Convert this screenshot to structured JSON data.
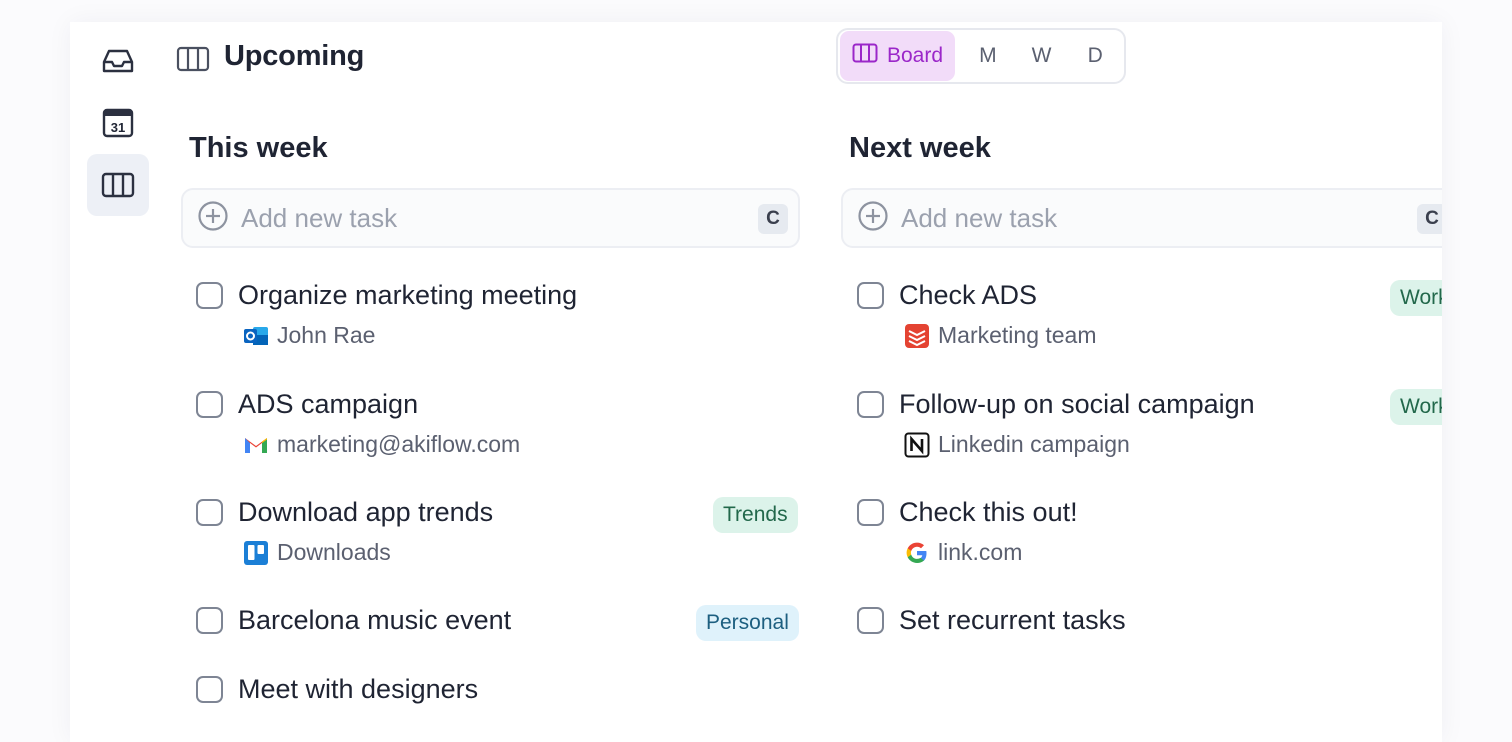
{
  "header": {
    "title": "Upcoming",
    "views": [
      {
        "label": "Board",
        "active": true
      },
      {
        "label": "M",
        "active": false
      },
      {
        "label": "W",
        "active": false
      },
      {
        "label": "D",
        "active": false
      }
    ]
  },
  "sidebar": {
    "items": [
      {
        "icon": "inbox-icon"
      },
      {
        "icon": "calendar-icon",
        "label": "31"
      },
      {
        "icon": "board-icon",
        "active": true
      }
    ]
  },
  "columns": [
    {
      "title": "This week",
      "add_placeholder": "Add new task",
      "shortcut": "C",
      "tasks": [
        {
          "title": "Organize marketing meeting",
          "source": "John Rae",
          "source_icon": "outlook-icon"
        },
        {
          "title": "ADS campaign",
          "source": "marketing@akiflow.com",
          "source_icon": "gmail-icon"
        },
        {
          "title": "Download app trends",
          "source": "Downloads",
          "source_icon": "trello-icon",
          "tag": "Trends"
        },
        {
          "title": "Barcelona music event",
          "tag": "Personal"
        },
        {
          "title": "Meet with designers"
        }
      ]
    },
    {
      "title": "Next week",
      "add_placeholder": "Add new task",
      "shortcut": "C",
      "tasks": [
        {
          "title": "Check ADS",
          "source": "Marketing team",
          "source_icon": "todoist-icon",
          "tag": "Work"
        },
        {
          "title": "Follow-up on social campaign",
          "source": "Linkedin campaign",
          "source_icon": "notion-icon",
          "tag": "Work"
        },
        {
          "title": "Check this out!",
          "source": "link.com",
          "source_icon": "google-icon"
        },
        {
          "title": "Set recurrent tasks"
        }
      ]
    }
  ],
  "colors": {
    "accent": "#9b27c9",
    "accent_bg": "#f2dcf9",
    "work_tag_bg": "#dcf3ea",
    "personal_tag_bg": "#dff2fb"
  }
}
